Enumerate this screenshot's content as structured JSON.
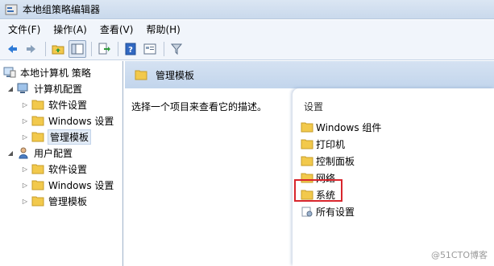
{
  "window": {
    "title": "本地组策略编辑器"
  },
  "menu": [
    "文件(F)",
    "操作(A)",
    "查看(V)",
    "帮助(H)"
  ],
  "toolbar": {
    "buttons": [
      "back-icon",
      "forward-icon",
      "up-folder-icon",
      "show-hide-tree-icon",
      "export-list-icon",
      "help-icon",
      "properties-icon",
      "filter-icon"
    ]
  },
  "tree": {
    "root": "本地计算机 策略",
    "computer_config": "计算机配置",
    "computer_children": [
      "软件设置",
      "Windows 设置",
      "管理模板"
    ],
    "user_config": "用户配置",
    "user_children": [
      "软件设置",
      "Windows 设置",
      "管理模板"
    ]
  },
  "right": {
    "header": "管理模板",
    "description": "选择一个项目来查看它的描述。",
    "column_header": "设置",
    "items": [
      "Windows 组件",
      "打印机",
      "控制面板",
      "网络",
      "系统",
      "所有设置"
    ]
  },
  "watermark": "@51CTO博客",
  "colors": {
    "highlight": "#d8262d",
    "folder": "#f2c94c"
  }
}
